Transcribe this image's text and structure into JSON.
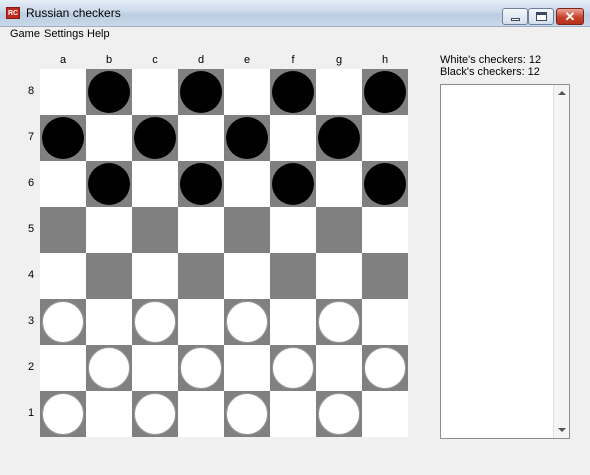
{
  "window": {
    "title": "Russian checkers",
    "icon_text": "RC",
    "controls": [
      "minimize",
      "maximize",
      "close"
    ]
  },
  "menu": [
    "Game",
    "Settings",
    "Help"
  ],
  "board": {
    "files": [
      "a",
      "b",
      "c",
      "d",
      "e",
      "f",
      "g",
      "h"
    ],
    "ranks": [
      "8",
      "7",
      "6",
      "5",
      "4",
      "3",
      "2",
      "1"
    ],
    "light_color": "#ffffff",
    "dark_color": "#808080",
    "pieces": {
      "b8": "black",
      "d8": "black",
      "f8": "black",
      "h8": "black",
      "a7": "black",
      "c7": "black",
      "e7": "black",
      "g7": "black",
      "b6": "black",
      "d6": "black",
      "f6": "black",
      "h6": "black",
      "a3": "white",
      "c3": "white",
      "e3": "white",
      "g3": "white",
      "b2": "white",
      "d2": "white",
      "f2": "white",
      "h2": "white",
      "a1": "white",
      "c1": "white",
      "e1": "white",
      "g1": "white"
    }
  },
  "status": {
    "white_checkers": "White's checkers: 12",
    "black_checkers": "Black's checkers: 12"
  },
  "move_log": {
    "entries": []
  }
}
